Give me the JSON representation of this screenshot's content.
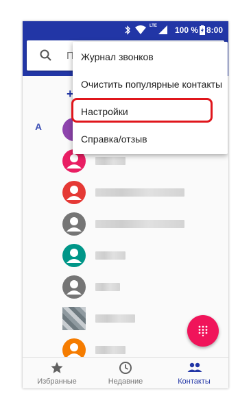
{
  "status_bar": {
    "network": "LTE",
    "battery": "100 %",
    "time": "8:00"
  },
  "search": {
    "placeholder": "П"
  },
  "list": {
    "add_symbol": "+",
    "section_letter": "A",
    "avatar_colors": [
      "#8e44ad",
      "#e91e63",
      "#e53935",
      "#757575",
      "#009688",
      "#757575",
      "photo",
      "#f57c00"
    ]
  },
  "menu": {
    "items": [
      {
        "label": "Журнал звонков"
      },
      {
        "label": "Очистить популярные контакты"
      },
      {
        "label": "Настройки",
        "highlighted": true
      },
      {
        "label": "Справка/отзыв"
      }
    ]
  },
  "bottom_nav": {
    "items": [
      {
        "label": "Избранные",
        "icon": "star-icon",
        "active": false
      },
      {
        "label": "Недавние",
        "icon": "clock-icon",
        "active": false
      },
      {
        "label": "Контакты",
        "icon": "people-icon",
        "active": true
      }
    ]
  },
  "colors": {
    "accent": "#2236a6",
    "fab": "#f0145a",
    "highlight": "#e0161c"
  }
}
